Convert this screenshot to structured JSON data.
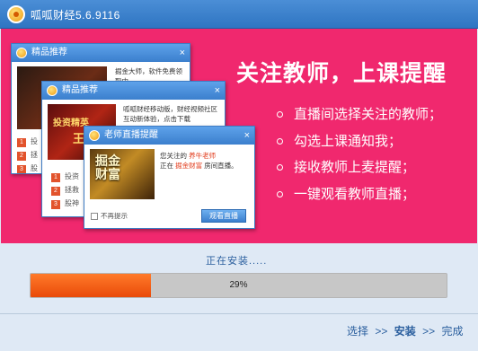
{
  "window": {
    "title": "呱呱财经5.6.9116"
  },
  "banner": {
    "headline": "关注教师，上课提醒",
    "bullets": [
      "直播间选择关注的教师；",
      "勾选上课通知我；",
      "接收教师上麦提醒；",
      "一键观看教师直播；"
    ]
  },
  "popup1": {
    "title": "精品推荐",
    "close": "×",
    "text": "掘金大师，软件免费领取中 ......",
    "items": [
      {
        "num": "1",
        "label": "投"
      },
      {
        "num": "2",
        "label": "拯"
      },
      {
        "num": "3",
        "label": "股"
      }
    ]
  },
  "popup2": {
    "title": "精品推荐",
    "close": "×",
    "text": "呱呱财经移动版，财经视频社区互动新体验，点击下载",
    "image_text": "投资精英",
    "image_text2": "王",
    "items": [
      {
        "num": "1",
        "label": "投资"
      },
      {
        "num": "2",
        "label": "拯救"
      },
      {
        "num": "3",
        "label": "股神"
      }
    ]
  },
  "popup3": {
    "title": "老师直播提醒",
    "close": "×",
    "image_brand": "掘金财富",
    "line1_prefix": "您关注的",
    "teacher": "养牛老师",
    "line2_prefix": "正在",
    "room": "掘金财富",
    "line2_suffix": "房间直播。",
    "checkbox_label": "不再提示",
    "watch_button": "观看直播"
  },
  "install": {
    "status": "正在安装.....",
    "progress_percent": 29,
    "progress_label": "29%",
    "progress_color": "#ef5a12"
  },
  "steps": {
    "items": [
      "选择",
      "安装",
      "完成"
    ],
    "separator": ">>",
    "current_index": 1
  }
}
